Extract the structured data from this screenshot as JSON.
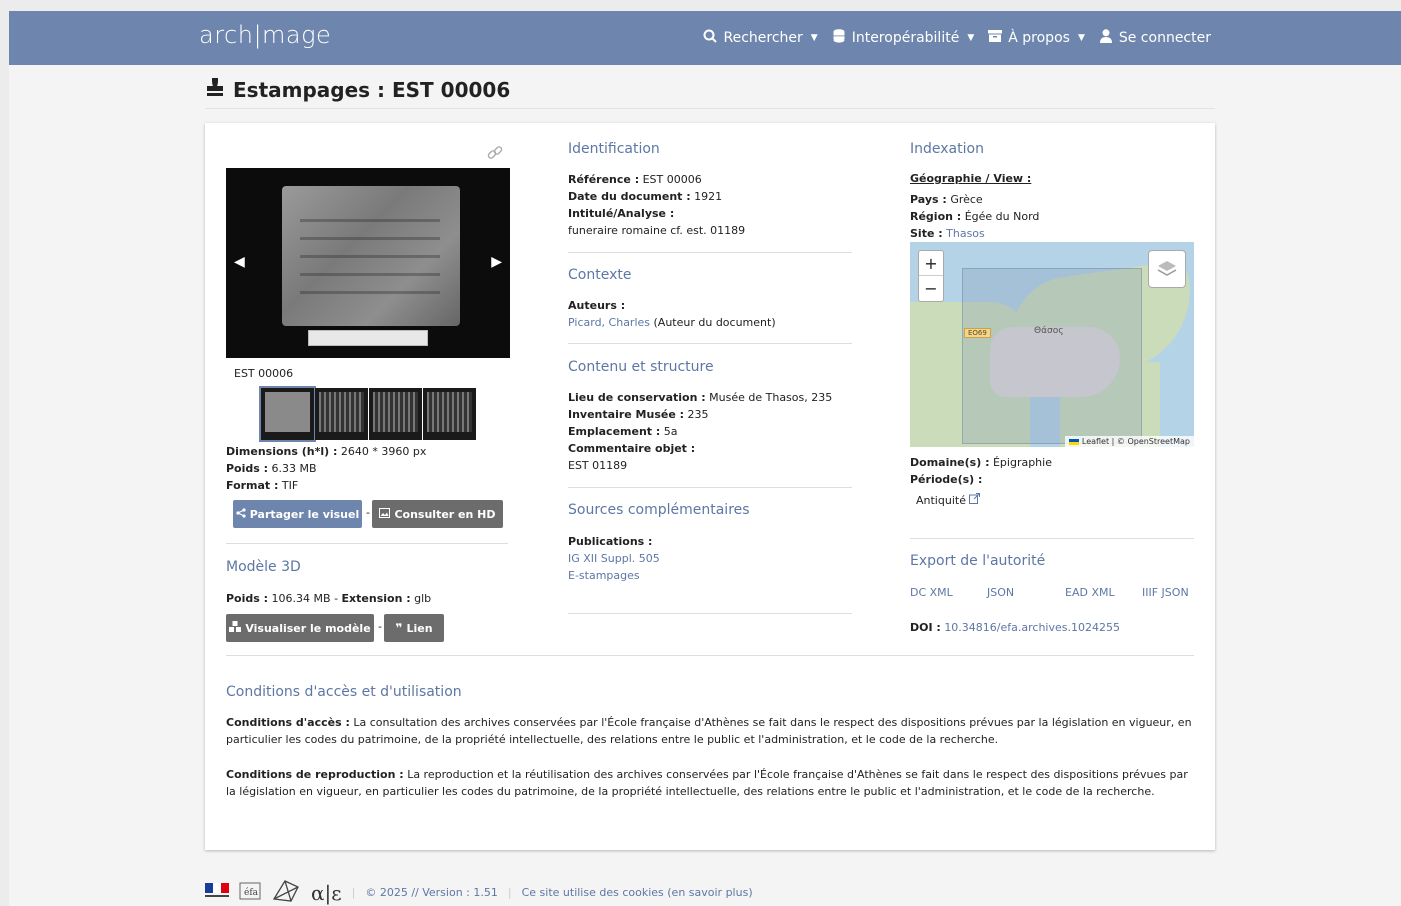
{
  "nav": {
    "logo": "arch|mage",
    "items": [
      {
        "icon": "search-icon",
        "label": "Rechercher"
      },
      {
        "icon": "database-icon",
        "label": "Interopérabilité"
      },
      {
        "icon": "archive-icon",
        "label": "À propos"
      },
      {
        "icon": "user-icon",
        "label": "Se connecter"
      }
    ]
  },
  "page": {
    "title": "Estampages : EST 00006",
    "title_icon": "stamp-icon"
  },
  "viewer": {
    "caption": "EST 00006",
    "thumb_count": 4,
    "prev_icon": "arrow-left-icon",
    "next_icon": "arrow-right-icon"
  },
  "file_info": {
    "dimensions_label": "Dimensions (h*l) :",
    "dimensions_value": "2640 * 3960 px",
    "poids_label": "Poids :",
    "poids_value": "6.33 MB",
    "format_label": "Format :",
    "format_value": "TIF",
    "share_button": "Partager le visuel",
    "hd_button": "Consulter en HD",
    "separator": "-"
  },
  "model3d": {
    "title": "Modèle 3D",
    "poids_label": "Poids :",
    "poids_value": "106.34 MB -",
    "extension_label": "Extension :",
    "extension_value": "glb",
    "view_button": "Visualiser le modèle",
    "link_button": "Lien"
  },
  "identification": {
    "title": "Identification",
    "reference_label": "Référence :",
    "reference_value": "EST 00006",
    "date_label": "Date du document :",
    "date_value": "1921",
    "intitule_label": "Intitulé/Analyse :",
    "intitule_value": "funeraire romaine cf. est. 01189"
  },
  "contexte": {
    "title": "Contexte",
    "auteurs_label": "Auteurs :",
    "auteur_link": "Picard, Charles",
    "auteur_role": "(Auteur du document)"
  },
  "contenu": {
    "title": "Contenu et structure",
    "lieu_label": "Lieu de conservation :",
    "lieu_value": "Musée de Thasos, 235",
    "inventaire_label": "Inventaire Musée :",
    "inventaire_value": "235",
    "emplacement_label": "Emplacement :",
    "emplacement_value": "5a",
    "commentaire_label": "Commentaire objet :",
    "commentaire_value": "EST 01189"
  },
  "sources": {
    "title": "Sources complémentaires",
    "publications_label": "Publications :",
    "links": [
      "IG XII Suppl. 505",
      "E-stampages"
    ]
  },
  "indexation": {
    "title": "Indexation",
    "geo_label": "Géographie / View :",
    "pays_label": "Pays :",
    "pays_value": "Grèce",
    "region_label": "Région :",
    "region_value": "Égée du Nord",
    "site_label": "Site :",
    "site_value": "Thasos",
    "domaine_label": "Domaine(s) :",
    "domaine_value": "Épigraphie",
    "periode_label": "Période(s) :",
    "periode_value": "Antiquité"
  },
  "map": {
    "zoom_in": "+",
    "zoom_out": "−",
    "attribution": "Leaflet | © OpenStreetMap",
    "city_label": "Θάσος",
    "road_label": "EO69"
  },
  "export": {
    "title": "Export de l'autorité",
    "links": [
      "DC XML",
      "JSON",
      "EAD XML",
      "IIIF JSON"
    ],
    "doi_label": "DOI :",
    "doi_value": "10.34816/efa.archives.1024255"
  },
  "conditions": {
    "title": "Conditions d'accès et d'utilisation",
    "acces_label": "Conditions d'accès :",
    "acces_text": "La consultation des archives conservées par l'École française d'Athènes se fait dans le respect des dispositions prévues par la législation en vigueur, en particulier les codes du patrimoine, de la propriété intellectuelle, des relations entre le public et l'administration, et le code de la recherche.",
    "repro_label": "Conditions de reproduction :",
    "repro_text": "La reproduction et la réutilisation des archives conservées par l'École française d'Athènes se fait dans le respect des dispositions prévues par la législation en vigueur, en particulier les codes du patrimoine, de la propriété intellectuelle, des relations entre le public et l'administration, et le code de la recherche."
  },
  "footer": {
    "version": "© 2025 // Version : 1.51",
    "cookies": "Ce site utilise des cookies (en savoir plus)"
  }
}
